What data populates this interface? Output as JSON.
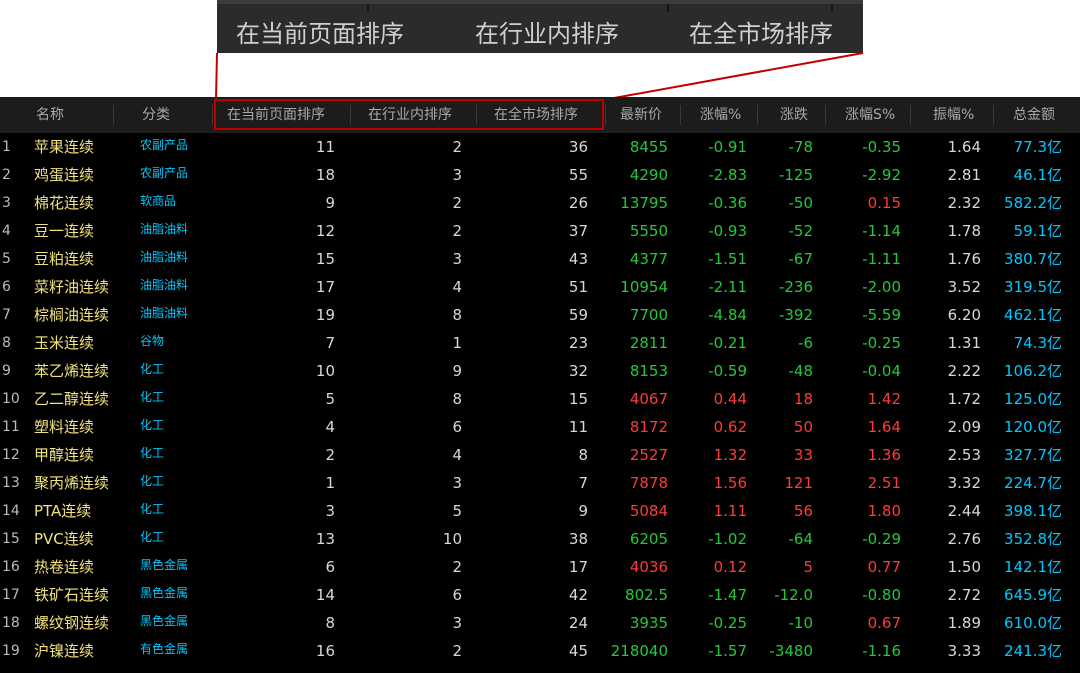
{
  "zoom": {
    "labels": [
      "在当前页面排序",
      "在行业内排序",
      "在全市场排序"
    ]
  },
  "header": {
    "name": "名称",
    "category": "分类",
    "rank_page": "在当前页面排序",
    "rank_industry": "在行业内排序",
    "rank_market": "在全市场排序",
    "price": "最新价",
    "pct": "涨幅%",
    "change": "涨跌",
    "pct5s": "涨幅S%",
    "amplitude": "振幅%",
    "total": "总金额"
  },
  "colors": {
    "up": "#ff3a3a",
    "down": "#22c93a",
    "name": "#f2e27a",
    "category": "#00c8ff",
    "highlight": "#c00000"
  },
  "rows": [
    {
      "idx": "1",
      "name": "苹果连续",
      "cat": "农副产品",
      "r1": "11",
      "r2": "2",
      "r3": "36",
      "price": "8455",
      "pct": "-0.91",
      "chg": "-78",
      "s5": "-0.35",
      "amp": "1.64",
      "total": "77.3亿",
      "dir": "dn",
      "s5dir": "dn"
    },
    {
      "idx": "2",
      "name": "鸡蛋连续",
      "cat": "农副产品",
      "r1": "18",
      "r2": "3",
      "r3": "55",
      "price": "4290",
      "pct": "-2.83",
      "chg": "-125",
      "s5": "-2.92",
      "amp": "2.81",
      "total": "46.1亿",
      "dir": "dn",
      "s5dir": "dn"
    },
    {
      "idx": "3",
      "name": "棉花连续",
      "cat": "软商品",
      "r1": "9",
      "r2": "2",
      "r3": "26",
      "price": "13795",
      "pct": "-0.36",
      "chg": "-50",
      "s5": "0.15",
      "amp": "2.32",
      "total": "582.2亿",
      "dir": "dn",
      "s5dir": "up"
    },
    {
      "idx": "4",
      "name": "豆一连续",
      "cat": "油脂油料",
      "r1": "12",
      "r2": "2",
      "r3": "37",
      "price": "5550",
      "pct": "-0.93",
      "chg": "-52",
      "s5": "-1.14",
      "amp": "1.78",
      "total": "59.1亿",
      "dir": "dn",
      "s5dir": "dn"
    },
    {
      "idx": "5",
      "name": "豆粕连续",
      "cat": "油脂油料",
      "r1": "15",
      "r2": "3",
      "r3": "43",
      "price": "4377",
      "pct": "-1.51",
      "chg": "-67",
      "s5": "-1.11",
      "amp": "1.76",
      "total": "380.7亿",
      "dir": "dn",
      "s5dir": "dn"
    },
    {
      "idx": "6",
      "name": "菜籽油连续",
      "cat": "油脂油料",
      "r1": "17",
      "r2": "4",
      "r3": "51",
      "price": "10954",
      "pct": "-2.11",
      "chg": "-236",
      "s5": "-2.00",
      "amp": "3.52",
      "total": "319.5亿",
      "dir": "dn",
      "s5dir": "dn"
    },
    {
      "idx": "7",
      "name": "棕榈油连续",
      "cat": "油脂油料",
      "r1": "19",
      "r2": "8",
      "r3": "59",
      "price": "7700",
      "pct": "-4.84",
      "chg": "-392",
      "s5": "-5.59",
      "amp": "6.20",
      "total": "462.1亿",
      "dir": "dn",
      "s5dir": "dn"
    },
    {
      "idx": "8",
      "name": "玉米连续",
      "cat": "谷物",
      "r1": "7",
      "r2": "1",
      "r3": "23",
      "price": "2811",
      "pct": "-0.21",
      "chg": "-6",
      "s5": "-0.25",
      "amp": "1.31",
      "total": "74.3亿",
      "dir": "dn",
      "s5dir": "dn"
    },
    {
      "idx": "9",
      "name": "苯乙烯连续",
      "cat": "化工",
      "r1": "10",
      "r2": "9",
      "r3": "32",
      "price": "8153",
      "pct": "-0.59",
      "chg": "-48",
      "s5": "-0.04",
      "amp": "2.22",
      "total": "106.2亿",
      "dir": "dn",
      "s5dir": "dn"
    },
    {
      "idx": "10",
      "name": "乙二醇连续",
      "cat": "化工",
      "r1": "5",
      "r2": "8",
      "r3": "15",
      "price": "4067",
      "pct": "0.44",
      "chg": "18",
      "s5": "1.42",
      "amp": "1.72",
      "total": "125.0亿",
      "dir": "up",
      "s5dir": "up"
    },
    {
      "idx": "11",
      "name": "塑料连续",
      "cat": "化工",
      "r1": "4",
      "r2": "6",
      "r3": "11",
      "price": "8172",
      "pct": "0.62",
      "chg": "50",
      "s5": "1.64",
      "amp": "2.09",
      "total": "120.0亿",
      "dir": "up",
      "s5dir": "up"
    },
    {
      "idx": "12",
      "name": "甲醇连续",
      "cat": "化工",
      "r1": "2",
      "r2": "4",
      "r3": "8",
      "price": "2527",
      "pct": "1.32",
      "chg": "33",
      "s5": "1.36",
      "amp": "2.53",
      "total": "327.7亿",
      "dir": "up",
      "s5dir": "up"
    },
    {
      "idx": "13",
      "name": "聚丙烯连续",
      "cat": "化工",
      "r1": "1",
      "r2": "3",
      "r3": "7",
      "price": "7878",
      "pct": "1.56",
      "chg": "121",
      "s5": "2.51",
      "amp": "3.32",
      "total": "224.7亿",
      "dir": "up",
      "s5dir": "up"
    },
    {
      "idx": "14",
      "name": "PTA连续",
      "cat": "化工",
      "r1": "3",
      "r2": "5",
      "r3": "9",
      "price": "5084",
      "pct": "1.11",
      "chg": "56",
      "s5": "1.80",
      "amp": "2.44",
      "total": "398.1亿",
      "dir": "up",
      "s5dir": "up"
    },
    {
      "idx": "15",
      "name": "PVC连续",
      "cat": "化工",
      "r1": "13",
      "r2": "10",
      "r3": "38",
      "price": "6205",
      "pct": "-1.02",
      "chg": "-64",
      "s5": "-0.29",
      "amp": "2.76",
      "total": "352.8亿",
      "dir": "dn",
      "s5dir": "dn"
    },
    {
      "idx": "16",
      "name": "热卷连续",
      "cat": "黑色金属",
      "r1": "6",
      "r2": "2",
      "r3": "17",
      "price": "4036",
      "pct": "0.12",
      "chg": "5",
      "s5": "0.77",
      "amp": "1.50",
      "total": "142.1亿",
      "dir": "up",
      "s5dir": "up"
    },
    {
      "idx": "17",
      "name": "铁矿石连续",
      "cat": "黑色金属",
      "r1": "14",
      "r2": "6",
      "r3": "42",
      "price": "802.5",
      "pct": "-1.47",
      "chg": "-12.0",
      "s5": "-0.80",
      "amp": "2.72",
      "total": "645.9亿",
      "dir": "dn",
      "s5dir": "dn"
    },
    {
      "idx": "18",
      "name": "螺纹钢连续",
      "cat": "黑色金属",
      "r1": "8",
      "r2": "3",
      "r3": "24",
      "price": "3935",
      "pct": "-0.25",
      "chg": "-10",
      "s5": "0.67",
      "amp": "1.89",
      "total": "610.0亿",
      "dir": "dn",
      "s5dir": "up"
    },
    {
      "idx": "19",
      "name": "沪镍连续",
      "cat": "有色金属",
      "r1": "16",
      "r2": "2",
      "r3": "45",
      "price": "218040",
      "pct": "-1.57",
      "chg": "-3480",
      "s5": "-1.16",
      "amp": "3.33",
      "total": "241.3亿",
      "dir": "dn",
      "s5dir": "dn"
    }
  ]
}
